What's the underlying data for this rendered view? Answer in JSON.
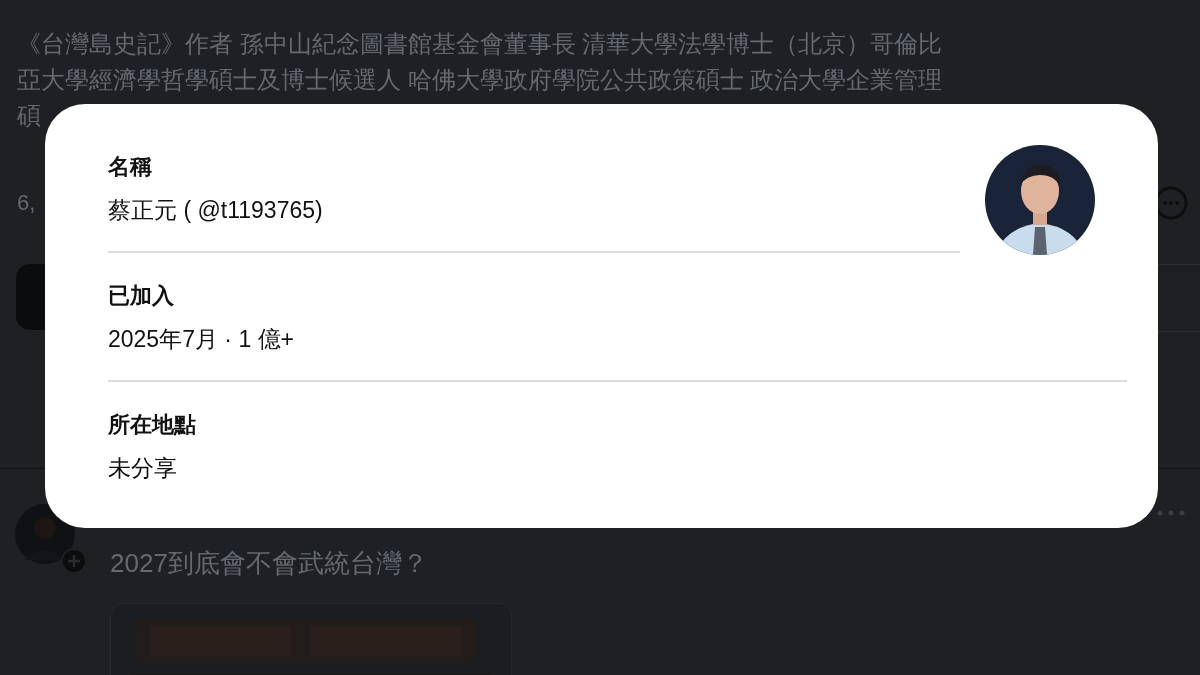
{
  "profile": {
    "bio_lines": [
      "《台灣島史記》作者 孫中山紀念圖書館基金會董事長 清華大學法學博士（北京）哥倫比",
      "亞大學經濟學哲學碩士及博士候選人 哈佛大學政府學院公共政策碩士 政治大學企業管理",
      "碩"
    ],
    "followers": "6,"
  },
  "post": {
    "text": "2027到底會不會武統台灣？"
  },
  "about_dialog": {
    "rows": [
      {
        "label": "名稱",
        "value": "蔡正元 ( @t1193765)"
      },
      {
        "label": "已加入",
        "value": "2025年7月 · 1 億+"
      },
      {
        "label": "所在地點",
        "value": "未分享"
      }
    ]
  }
}
